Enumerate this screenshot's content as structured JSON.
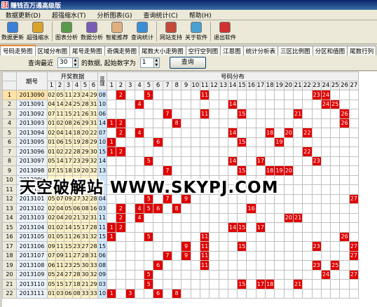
{
  "window": {
    "title": "赚钱百万通高级版"
  },
  "menu": [
    "数据更新(D)",
    "超强缩水(T)",
    "分析图表(G)",
    "查询统计(C)",
    "帮助(H)"
  ],
  "toolbar": [
    {
      "label": "数据更新",
      "icon": "data-update-icon",
      "color": "#3b7fd6"
    },
    {
      "label": "超强缩水",
      "icon": "filter-icon",
      "color": "#d9a32b"
    },
    {
      "label": "图表分析",
      "icon": "chart-analysis-icon",
      "color": "#5a9b4b"
    },
    {
      "label": "数据分析",
      "icon": "data-analysis-icon",
      "color": "#7a5cb4"
    },
    {
      "label": "智能推荐",
      "icon": "hand-icon",
      "color": "#e0b080"
    },
    {
      "label": "查询统计",
      "icon": "globe-icon",
      "color": "#3a8ed8"
    },
    {
      "label": "网站支持",
      "icon": "home-icon",
      "color": "#c44a3a"
    },
    {
      "label": "关于软件",
      "icon": "about-icon",
      "color": "#4aa0d0"
    },
    {
      "label": "退出软件",
      "icon": "exit-icon",
      "color": "#d03030"
    }
  ],
  "tabs": [
    "号码走势图",
    "区域分布图",
    "尾号走势图",
    "奇偶走势图",
    "尾数大小走势图",
    "空行空列图",
    "江恩图",
    "统计分析表",
    "三区比例图",
    "分区和值图",
    "尾数行列"
  ],
  "query": {
    "prefix": "查询最近",
    "recent": "30",
    "mid": "的数据, 起始数字为",
    "start": "1",
    "button": "查询"
  },
  "grid": {
    "header_issue": "期号",
    "header_open": "开奖数据",
    "header_blue": "蓝球",
    "header_dist": "号码分布",
    "dist_numbers": [
      "1",
      "2",
      "3",
      "4",
      "5",
      "6",
      "7",
      "8",
      "9",
      "10",
      "11",
      "12",
      "13",
      "14",
      "15",
      "16",
      "17",
      "18",
      "19",
      "20",
      "21",
      "22",
      "23",
      "24",
      "25",
      "26",
      "27"
    ],
    "rows": [
      {
        "n": "1",
        "issue": "2013090",
        "balls": [
          "02",
          "05",
          "11",
          "23",
          "24",
          "29"
        ],
        "blue": "08"
      },
      {
        "n": "2",
        "issue": "2013091",
        "balls": [
          "04",
          "14",
          "24",
          "25",
          "28",
          "31"
        ],
        "blue": "10"
      },
      {
        "n": "3",
        "issue": "2013092",
        "balls": [
          "07",
          "11",
          "15",
          "21",
          "26",
          "31"
        ],
        "blue": "06"
      },
      {
        "n": "4",
        "issue": "2013093",
        "balls": [
          "01",
          "02",
          "08",
          "26",
          "29",
          "31"
        ],
        "blue": "14"
      },
      {
        "n": "5",
        "issue": "2013094",
        "balls": [
          "02",
          "04",
          "14",
          "18",
          "20",
          "22"
        ],
        "blue": "07"
      },
      {
        "n": "6",
        "issue": "2013095",
        "balls": [
          "01",
          "06",
          "15",
          "19",
          "28",
          "29"
        ],
        "blue": "10"
      },
      {
        "n": "7",
        "issue": "2013096",
        "balls": [
          "01",
          "02",
          "22",
          "28",
          "29",
          "30"
        ],
        "blue": "15"
      },
      {
        "n": "8",
        "issue": "2013097",
        "balls": [
          "05",
          "14",
          "17",
          "23",
          "29",
          "32"
        ],
        "blue": "14"
      },
      {
        "n": "9",
        "issue": "2013098",
        "balls": [
          "07",
          "15",
          "18",
          "19",
          "20",
          "32"
        ],
        "blue": "13"
      },
      {
        "n": "10",
        "issue": "2013099",
        "balls": [
          "",
          "",
          "",
          "",
          "",
          ""
        ],
        "blue": ""
      },
      {
        "n": "11",
        "issue": "2013101",
        "balls": [
          "",
          "",
          "",
          "",
          "",
          ""
        ],
        "blue": ""
      },
      {
        "n": "12",
        "issue": "2013101",
        "balls": [
          "05",
          "07",
          "09",
          "27",
          "32",
          "28"
        ],
        "blue": "04"
      },
      {
        "n": "13",
        "issue": "2013102",
        "balls": [
          "02",
          "04",
          "05",
          "06",
          "08",
          "16"
        ],
        "blue": "03"
      },
      {
        "n": "14",
        "issue": "2013103",
        "balls": [
          "02",
          "04",
          "20",
          "21",
          "32",
          "31"
        ],
        "blue": "11"
      },
      {
        "n": "15",
        "issue": "2013104",
        "balls": [
          "01",
          "02",
          "14",
          "15",
          "17",
          "28"
        ],
        "blue": "11"
      },
      {
        "n": "16",
        "issue": "2013105",
        "balls": [
          "01",
          "05",
          "11",
          "26",
          "31",
          "32"
        ],
        "blue": "15"
      },
      {
        "n": "17",
        "issue": "2013106",
        "balls": [
          "09",
          "11",
          "15",
          "23",
          "27",
          "28"
        ],
        "blue": "15"
      },
      {
        "n": "18",
        "issue": "2013107",
        "balls": [
          "07",
          "09",
          "11",
          "27",
          "28",
          "31"
        ],
        "blue": "06"
      },
      {
        "n": "19",
        "issue": "2013108",
        "balls": [
          "06",
          "11",
          "23",
          "25",
          "30",
          "33"
        ],
        "blue": "08"
      },
      {
        "n": "20",
        "issue": "2013109",
        "balls": [
          "05",
          "24",
          "27",
          "28",
          "30",
          "32"
        ],
        "blue": "09"
      },
      {
        "n": "21",
        "issue": "2013110",
        "balls": [
          "05",
          "15",
          "17",
          "18",
          "21",
          "29"
        ],
        "blue": "03"
      },
      {
        "n": "22",
        "issue": "2013111",
        "balls": [
          "01",
          "03",
          "06",
          "08",
          "33",
          "33"
        ],
        "blue": "10"
      }
    ]
  },
  "watermark": "天空破解站 WWW.SKYPJ.COM",
  "colors": {
    "hit": "#e00000",
    "red_ball_bg": "#fff3c6",
    "blue_ball_bg": "#cfe8ff",
    "selected_row": "#ffe2a6"
  }
}
